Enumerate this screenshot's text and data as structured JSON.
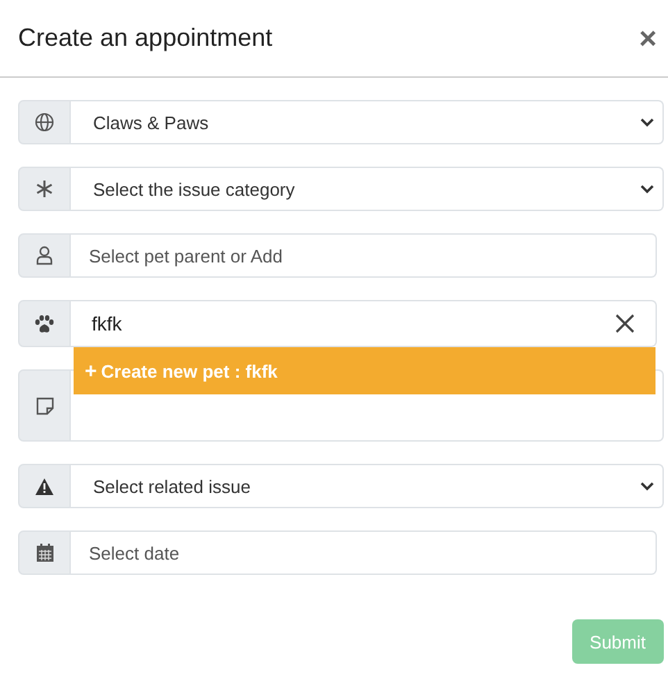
{
  "modal": {
    "title": "Create an appointment",
    "close": "×"
  },
  "fields": [
    {
      "kind": "select",
      "value": "Claws & Paws"
    },
    {
      "kind": "select",
      "value": "Select the issue category"
    },
    {
      "kind": "input",
      "placeholder": "Select pet parent or Add"
    },
    {
      "kind": "combo",
      "value": "fkfk",
      "options": [
        {
          "icon": "+",
          "label": "Create new pet :  fkfk",
          "selected": true
        }
      ]
    },
    {
      "kind": "textarea"
    },
    {
      "kind": "select",
      "value": "Select related issue"
    },
    {
      "kind": "input",
      "placeholder": "Select date"
    }
  ],
  "submit": {
    "label": "Submit",
    "disabled": true
  }
}
